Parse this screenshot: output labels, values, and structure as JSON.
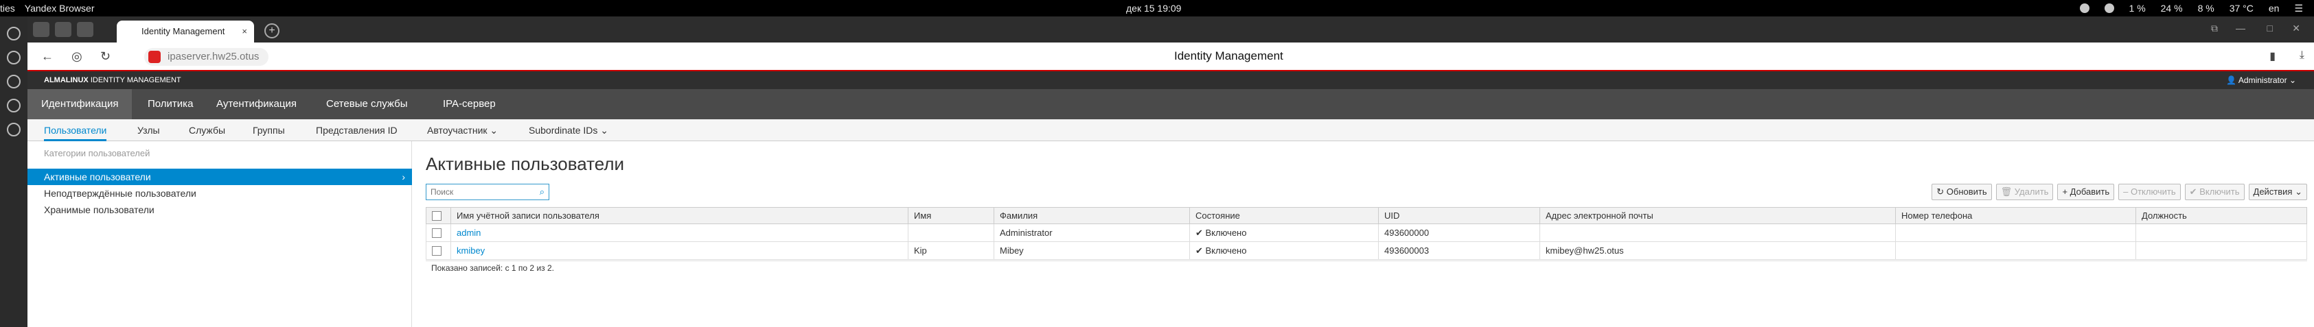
{
  "system_bar": {
    "apps_label": "ties",
    "browser_label": "Yandex Browser",
    "clock": "дек 15  19:09",
    "tray": [
      "1 %",
      "24 %",
      "8 %",
      "37 °C",
      "en"
    ]
  },
  "browser": {
    "tab_title": "Identity Management",
    "url": "ipaserver.hw25.otus",
    "page_title": "Identity Management"
  },
  "brand": {
    "brand_prefix": "ALMALINUX",
    "brand_suffix": "IDENTITY MANAGEMENT",
    "user": "Administrator"
  },
  "main_menu": [
    "Идентификация",
    "Политика",
    "Аутентификация",
    "Сетевые службы",
    "IPA-сервер"
  ],
  "sub_menu": [
    "Пользователи",
    "Узлы",
    "Службы",
    "Группы",
    "Представления ID",
    "Автоучастник ⌄",
    "Subordinate IDs ⌄"
  ],
  "left_panel": {
    "header": "Категории пользователей",
    "items": [
      "Активные пользователи",
      "Неподтверждённые пользователи",
      "Хранимые пользователи"
    ]
  },
  "content": {
    "title": "Активные пользователи",
    "search_placeholder": "Поиск",
    "actions": {
      "refresh": "Обновить",
      "delete": "Удалить",
      "add": "Добавить",
      "disable": "Отключить",
      "enable": "Включить",
      "actions": "Действия"
    },
    "columns": [
      "Имя учётной записи пользователя",
      "Имя",
      "Фамилия",
      "Состояние",
      "UID",
      "Адрес электронной почты",
      "Номер телефона",
      "Должность"
    ],
    "rows": [
      {
        "login": "admin",
        "first": "",
        "last": "Administrator",
        "state": "✔ Включено",
        "uid": "493600000",
        "email": "",
        "phone": "",
        "title": ""
      },
      {
        "login": "kmibey",
        "first": "Kip",
        "last": "Mibey",
        "state": "✔ Включено",
        "uid": "493600003",
        "email": "kmibey@hw25.otus",
        "phone": "",
        "title": ""
      }
    ],
    "footer": "Показано записей: с 1 по 2 из 2."
  }
}
